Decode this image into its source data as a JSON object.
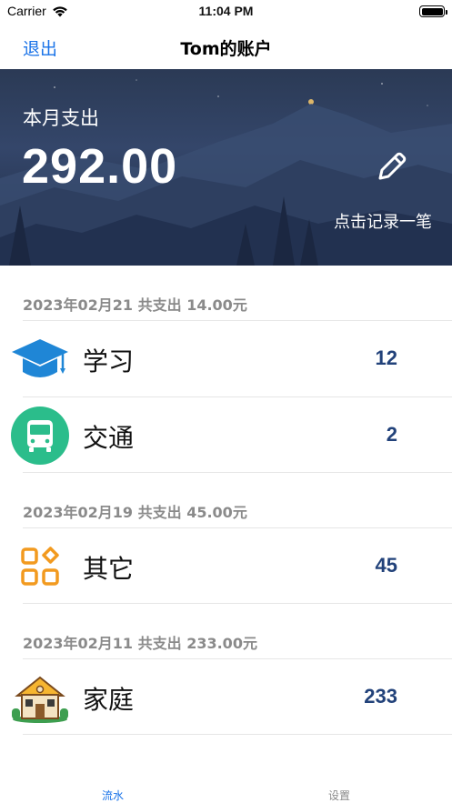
{
  "status_bar": {
    "carrier": "Carrier",
    "time": "11:04 PM"
  },
  "nav": {
    "back_label": "退出",
    "title": "Tom的账户"
  },
  "hero": {
    "label": "本月支出",
    "amount": "292.00",
    "action_label": "点击记录一笔",
    "action_icon": "pencil-icon"
  },
  "groups": [
    {
      "header": "2023年02月21 共支出 14.00元",
      "items": [
        {
          "icon": "graduation-cap-icon",
          "label": "学习",
          "value": "12"
        },
        {
          "icon": "bus-icon",
          "label": "交通",
          "value": "2"
        }
      ]
    },
    {
      "header": "2023年02月19 共支出 45.00元",
      "items": [
        {
          "icon": "grid-icon",
          "label": "其它",
          "value": "45"
        }
      ]
    },
    {
      "header": "2023年02月11 共支出 233.00元",
      "items": [
        {
          "icon": "house-icon",
          "label": "家庭",
          "value": "233"
        }
      ]
    }
  ],
  "tabs": {
    "active": "流水",
    "inactive": "设置"
  },
  "colors": {
    "accent": "#1a73e8",
    "value": "#22427a",
    "bus_green": "#2bbd8b",
    "grid_orange": "#f29a1f",
    "cap_blue": "#1f86d6"
  }
}
